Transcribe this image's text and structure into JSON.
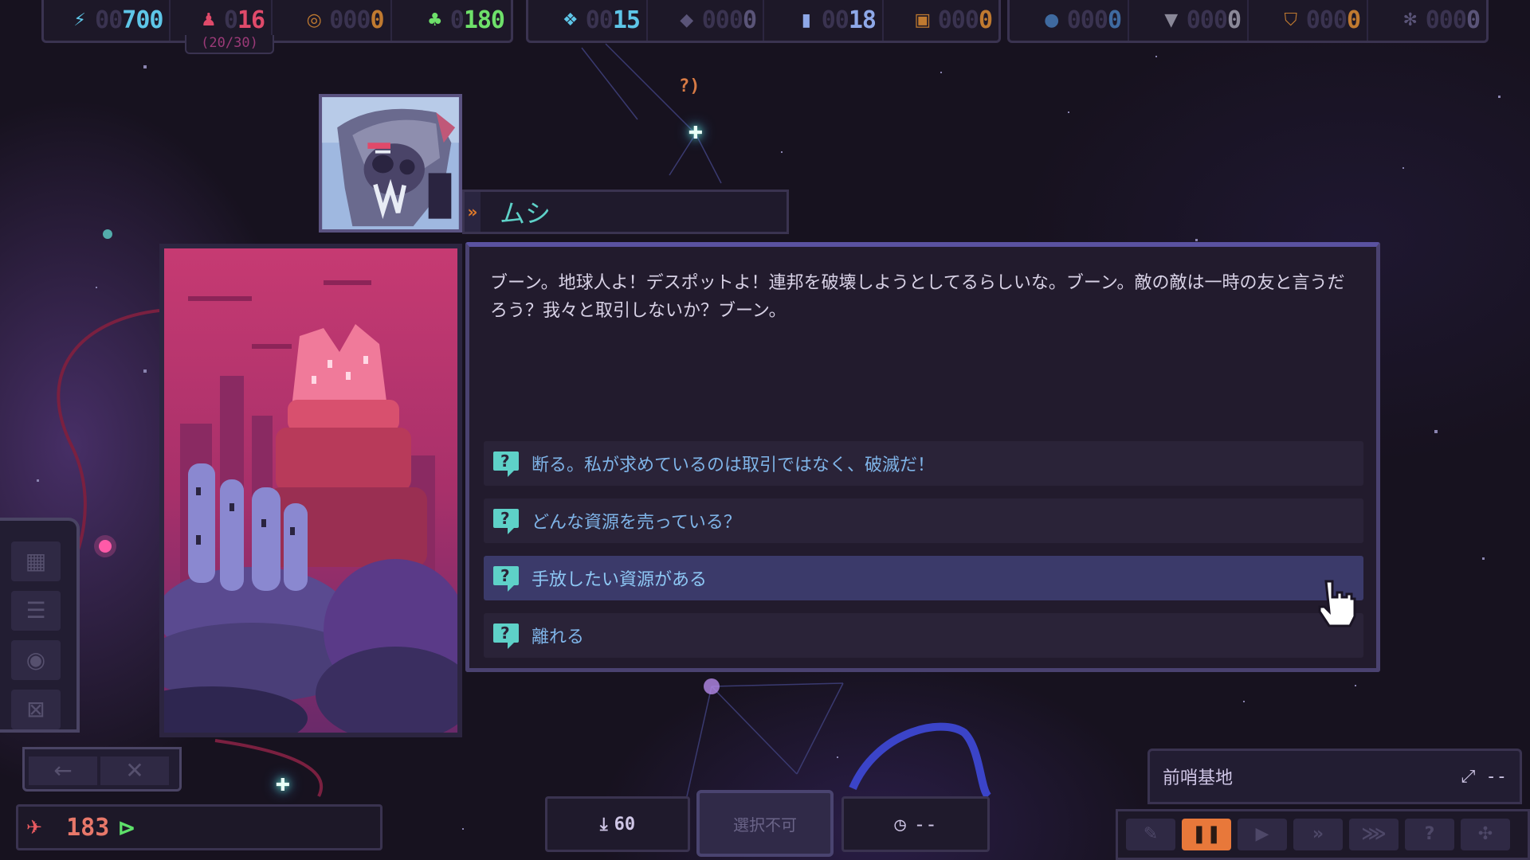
{
  "top_bar": {
    "group1": [
      {
        "icon": "lightning-icon",
        "value": "700",
        "faded": "00",
        "color": "#5ec6e8"
      },
      {
        "icon": "crew-icon",
        "value": "16",
        "faded": "0",
        "color": "#e04a6a"
      },
      {
        "icon": "core-icon",
        "value": "0",
        "faded": "000",
        "color": "#c07a30"
      },
      {
        "icon": "population-icon",
        "value": "180",
        "faded": "0",
        "color": "#6ee06a"
      }
    ],
    "crew_capacity": "(20/30)",
    "group2": [
      {
        "icon": "biomass-icon",
        "value": "15",
        "faded": "00",
        "color": "#5ec6e8"
      },
      {
        "icon": "crystal-icon",
        "value": "0",
        "faded": "000",
        "color": "#5a5478"
      },
      {
        "icon": "plate-icon",
        "value": "18",
        "faded": "00",
        "color": "#8ea8e8"
      },
      {
        "icon": "chip-icon",
        "value": "0",
        "faded": "000",
        "color": "#c07a30"
      }
    ],
    "group3": [
      {
        "icon": "drop-icon",
        "value": "0",
        "faded": "000",
        "color": "#3f6aa0"
      },
      {
        "icon": "anvil-icon",
        "value": "0",
        "faded": "000",
        "color": "#8a8898"
      },
      {
        "icon": "shield-icon",
        "value": "0",
        "faded": "000",
        "color": "#c07a30"
      },
      {
        "icon": "gear-icon",
        "value": "0",
        "faded": "000",
        "color": "#5a5478"
      }
    ]
  },
  "map": {
    "signal_label": "?"
  },
  "speaker": {
    "name": "ムシ",
    "portrait": "insectoid-alien-portrait"
  },
  "dialog": {
    "text": "ブーン。地球人よ！デスポットよ！連邦を破壊しようとしてるらしいな。ブーン。敵の敵は一時の友と言うだろう？我々と取引しないか？ブーン。",
    "options": [
      {
        "label": "断る。私が求めているのは取引ではなく、破滅だ！",
        "selected": false
      },
      {
        "label": "どんな資源を売っている？",
        "selected": false
      },
      {
        "label": "手放したい資源がある",
        "selected": true
      },
      {
        "label": "離れる",
        "selected": false
      }
    ]
  },
  "bottom_left": {
    "value": "183"
  },
  "bottom_center": {
    "download_value": "60",
    "action_label": "選択不可",
    "timer_label": "--"
  },
  "bottom_right": {
    "location_name": "前哨基地",
    "route_label": "--"
  },
  "colors": {
    "accent_teal": "#5ed1c8",
    "option_text": "#7fb4e8",
    "selected_option_bg": "#3b3a6a",
    "pause_active": "#e8783a"
  }
}
